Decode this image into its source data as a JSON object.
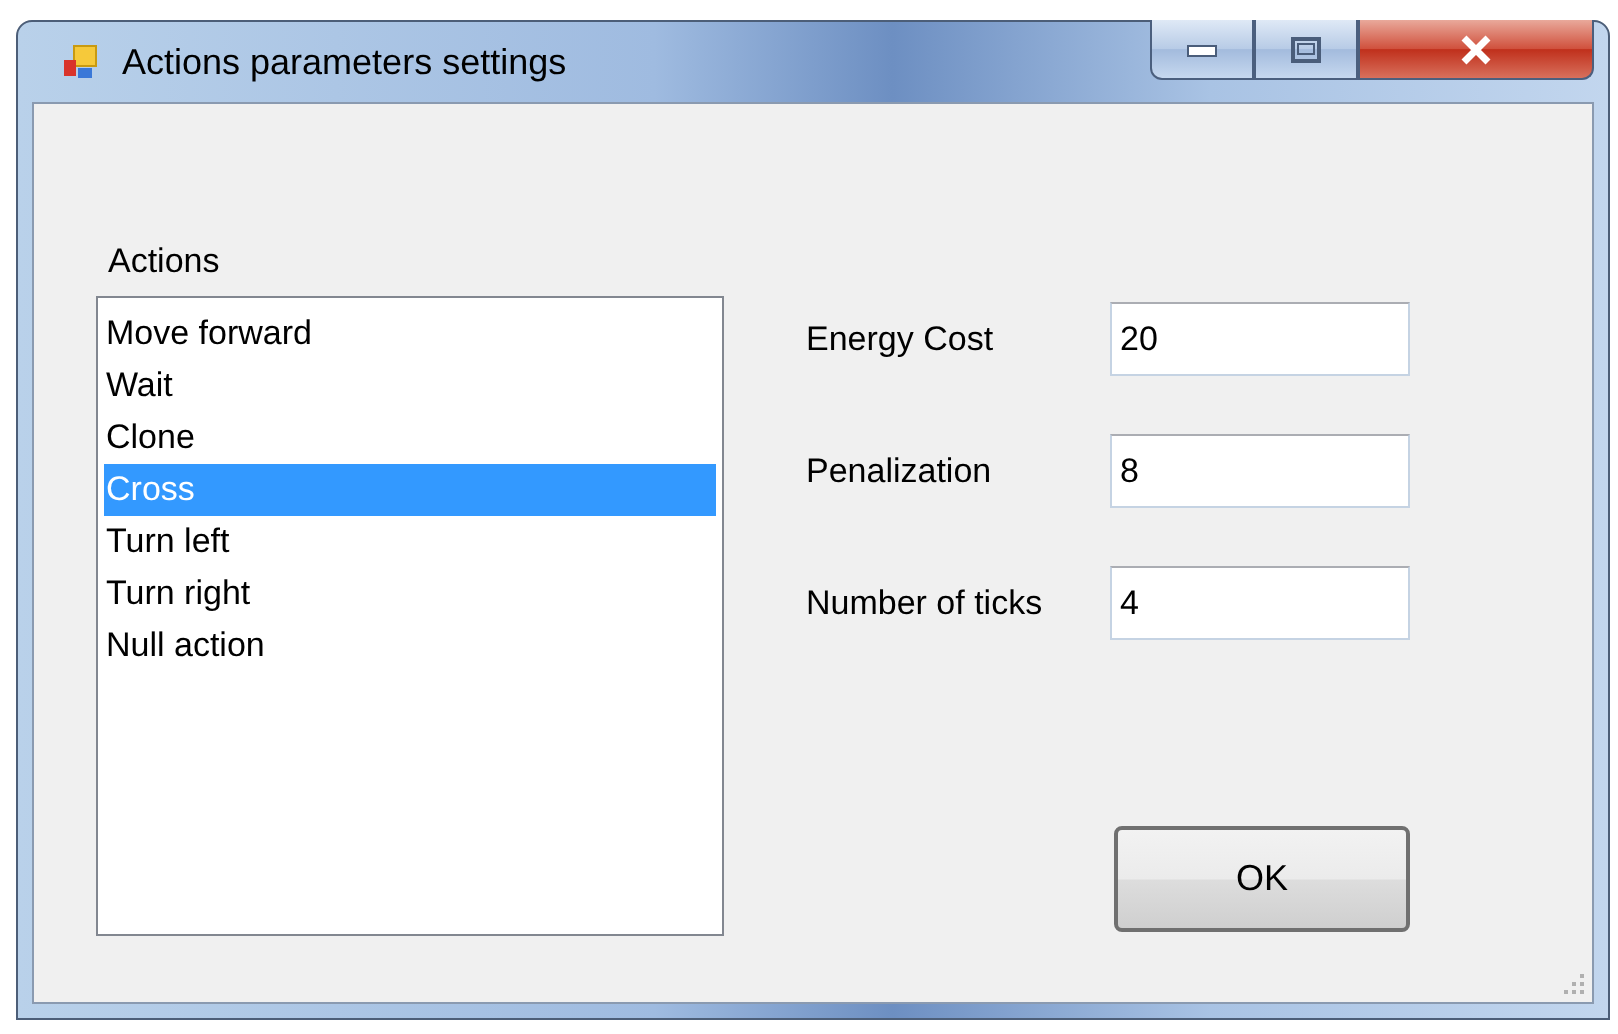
{
  "window": {
    "title": "Actions parameters settings"
  },
  "actions": {
    "label": "Actions",
    "items": [
      {
        "label": "Move forward",
        "selected": false
      },
      {
        "label": "Wait",
        "selected": false
      },
      {
        "label": "Clone",
        "selected": false
      },
      {
        "label": "Cross",
        "selected": true
      },
      {
        "label": "Turn left",
        "selected": false
      },
      {
        "label": "Turn right",
        "selected": false
      },
      {
        "label": "Null action",
        "selected": false
      }
    ]
  },
  "fields": [
    {
      "label": "Energy Cost",
      "value": "20"
    },
    {
      "label": "Penalization",
      "value": "8"
    },
    {
      "label": "Number of ticks",
      "value": "4"
    }
  ],
  "buttons": [
    "OK"
  ]
}
